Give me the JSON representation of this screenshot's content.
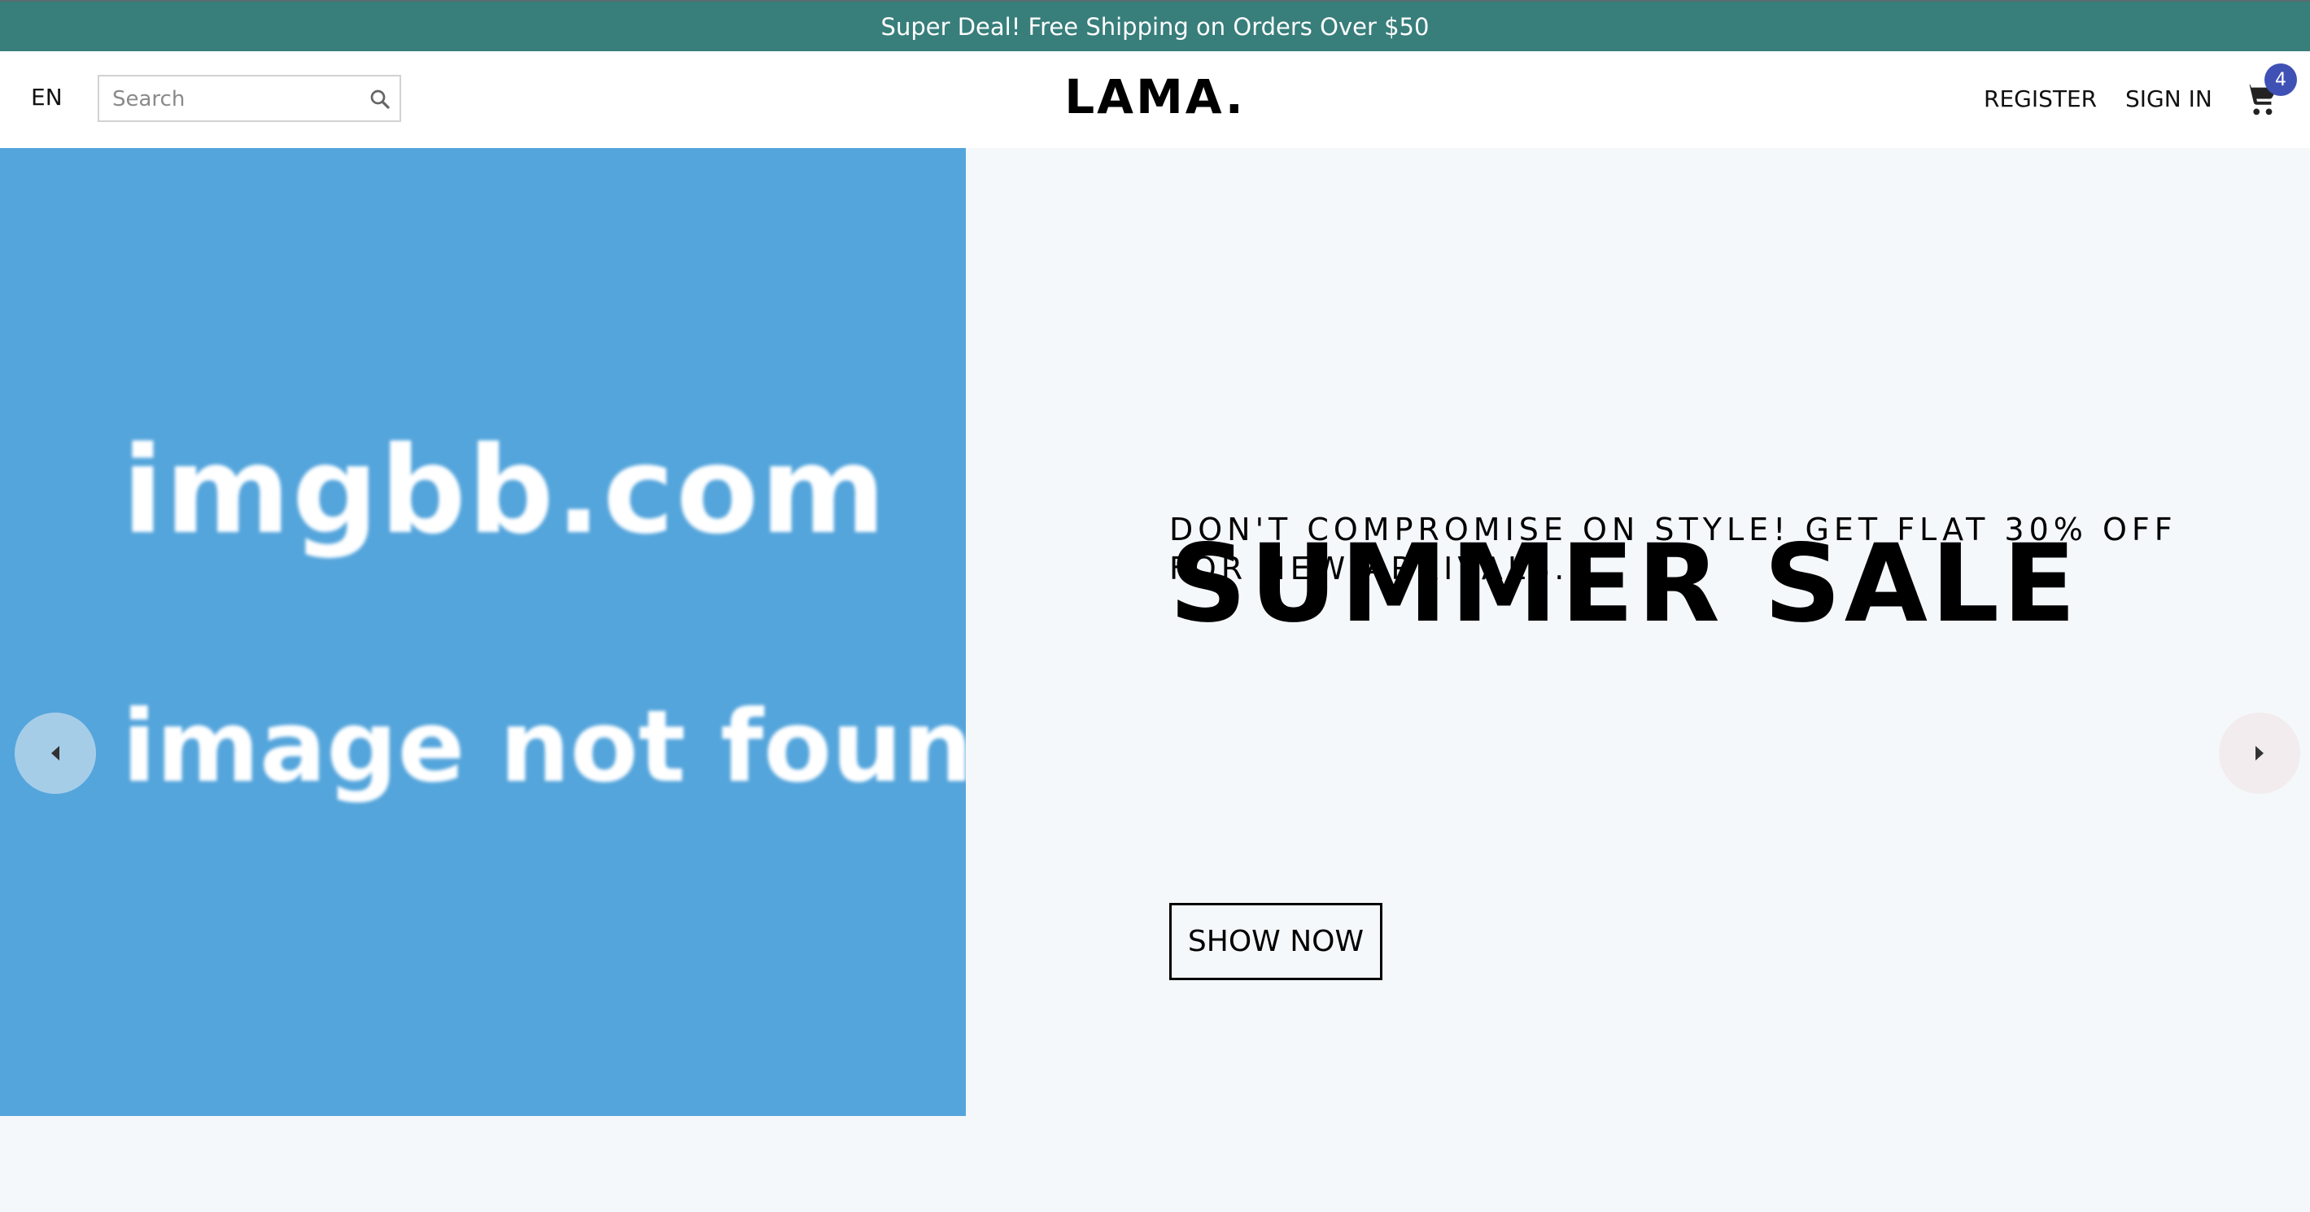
{
  "announcement": {
    "text": "Super Deal! Free Shipping on Orders Over $50"
  },
  "navbar": {
    "language": "EN",
    "search": {
      "placeholder": "Search",
      "value": "",
      "icon": "search-icon"
    },
    "logo": "LAMA.",
    "menu": {
      "register": "REGISTER",
      "sign_in": "SIGN IN"
    },
    "cart": {
      "icon": "cart-icon",
      "badge_count": "4",
      "badge_color": "#3f51b5"
    }
  },
  "slider": {
    "image_placeholder": {
      "line1": "imgbb.com",
      "line2": "image not found",
      "background": "#54a5dc"
    },
    "title": "SUMMER SALE",
    "description": "DON'T COMPROMISE ON STYLE! GET FLAT 30% OFF FOR NEW ARRIVALS.",
    "button": "SHOW NOW",
    "arrows": {
      "left": "arrow-left-icon",
      "right": "arrow-right-icon"
    }
  },
  "colors": {
    "announcement_bg": "#387e7b",
    "page_bg": "#f5f8fa"
  }
}
